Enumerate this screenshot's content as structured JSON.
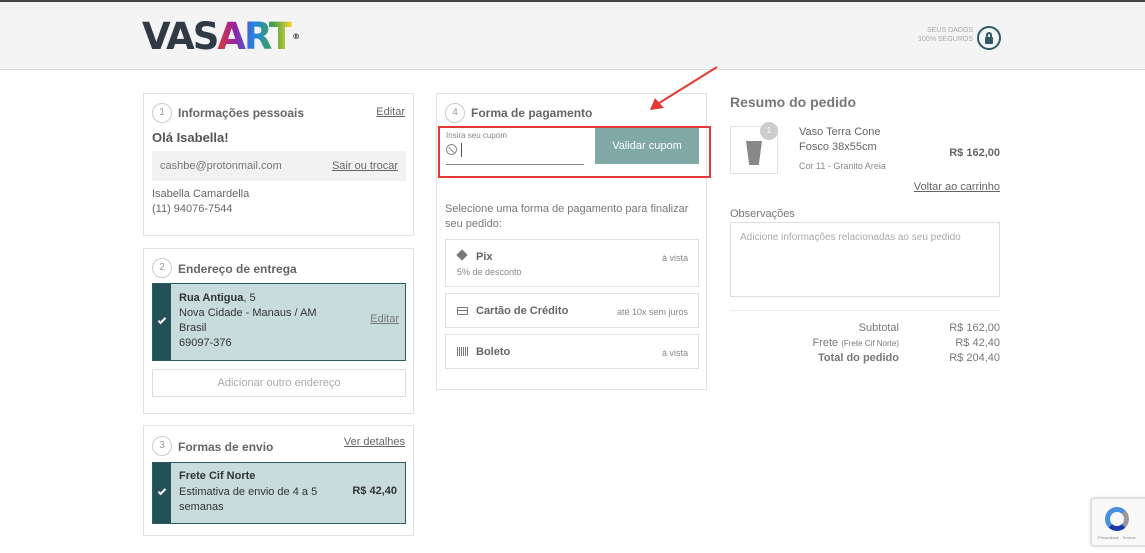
{
  "header": {
    "logo_main": "VAS",
    "logo_accent": "ART",
    "logo_reg": "®",
    "secure_line1": "SEUS DADOS",
    "secure_line2": "100% SEGUROS",
    "secure_icon": "lock-icon"
  },
  "personal": {
    "step": "1",
    "title": "Informações pessoais",
    "edit_label": "Editar",
    "greeting": "Olá Isabella!",
    "email": "cashbe@protonmail.com",
    "switch_label": "Sair ou trocar",
    "name": "Isabella Camardella",
    "phone": "(11) 94076-7544"
  },
  "delivery": {
    "step": "2",
    "title": "Endereço de entrega",
    "street": "Rua Antigua",
    "number": ", 5",
    "city": "Nova Cidade - Manaus / AM",
    "country": "Brasil",
    "zip": "69097-376",
    "edit_label": "Editar",
    "add_label": "Adicionar outro endereço"
  },
  "shipping": {
    "step": "3",
    "title": "Formas de envio",
    "details_label": "Ver detalhes",
    "method": "Frete Cif Norte",
    "estimate": "Estimativa de envio de 4 a 5 semanas",
    "price": "R$ 42,40"
  },
  "payment": {
    "step": "4",
    "title": "Forma de pagamento",
    "coupon_label": "Insira seu cupom",
    "coupon_value": "",
    "validate_label": "Validar cupom",
    "instructions": "Selecione uma forma de pagamento para finalizar seu pedido:",
    "options": [
      {
        "label": "Pix",
        "note": "à vista",
        "sub": "5% de desconto",
        "icon": "pix-icon"
      },
      {
        "label": "Cartão de Crédito",
        "note": "até 10x sem juros",
        "icon": "credit-card-icon"
      },
      {
        "label": "Boleto",
        "note": "à vista",
        "icon": "barcode-icon"
      }
    ]
  },
  "summary": {
    "title": "Resumo do pedido",
    "product": {
      "qty": "1",
      "name": "Vaso Terra Cone Fosco 38x55cm",
      "variant": "Cor 11 - Granito Areia",
      "price": "R$ 162,00"
    },
    "back_label": "Voltar ao carrinho",
    "notes_label": "Observações",
    "notes_placeholder": "Adicione informações relacionadas ao seu pedido",
    "subtotal_label": "Subtotal",
    "subtotal_value": "R$ 162,00",
    "shipping_label": "Frete",
    "shipping_detail": "(Frete Cif Norte)",
    "shipping_value": "R$ 42,40",
    "total_label": "Total do pedido",
    "total_value": "R$ 204,40"
  },
  "recaptcha": {
    "text": "Privacidade - Termos"
  },
  "colors": {
    "accent_dark": "#245058",
    "accent_light": "#c8dcdc",
    "validate_button": "#7fa8a6",
    "highlight": "#e53935"
  }
}
